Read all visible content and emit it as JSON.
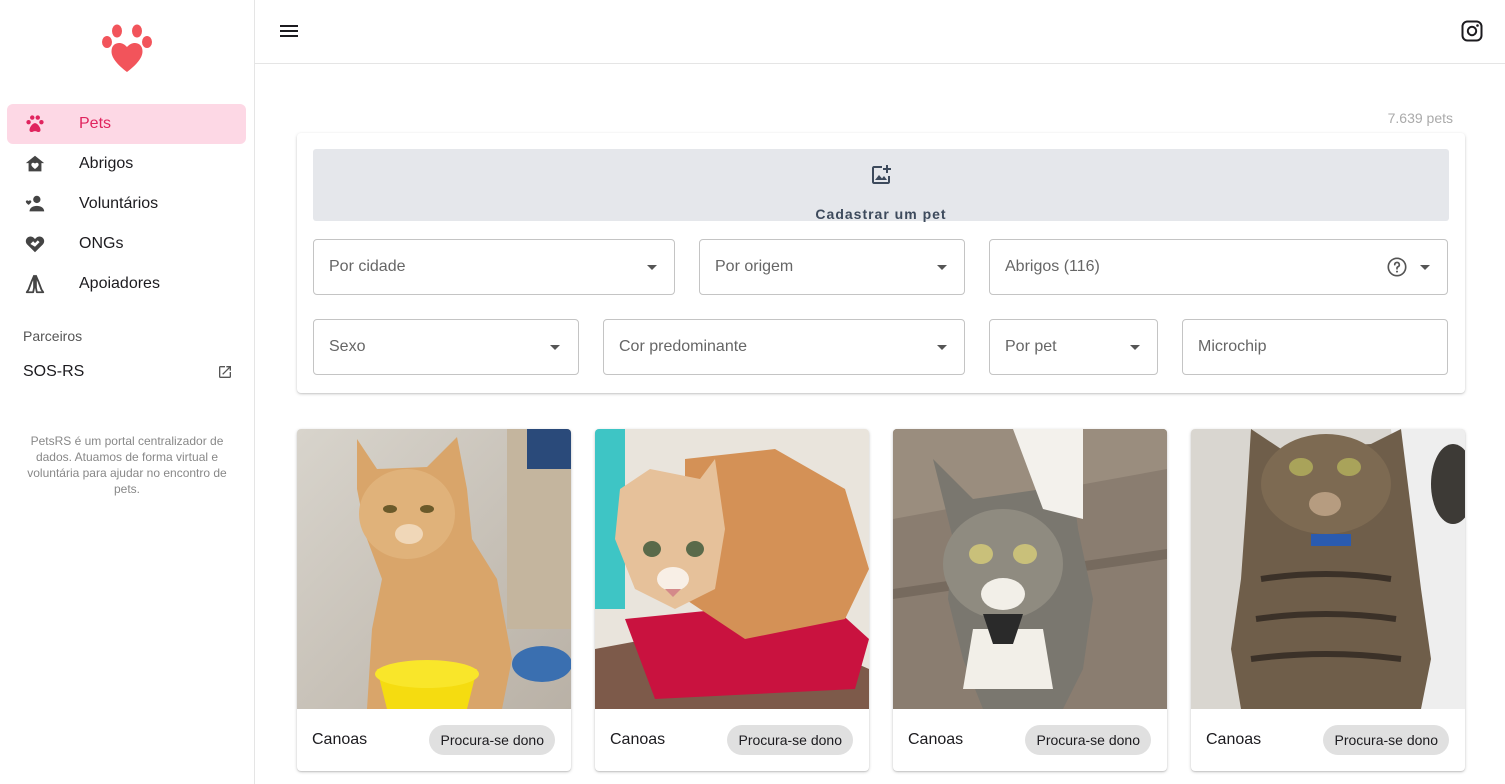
{
  "sidebar": {
    "items": [
      {
        "label": "Pets",
        "icon": "paw-icon",
        "active": true
      },
      {
        "label": "Abrigos",
        "icon": "house-heart-icon",
        "active": false
      },
      {
        "label": "Voluntários",
        "icon": "volunteer-icon",
        "active": false
      },
      {
        "label": "ONGs",
        "icon": "handshake-icon",
        "active": false
      },
      {
        "label": "Apoiadores",
        "icon": "praying-hands-icon",
        "active": false
      }
    ],
    "partners_title": "Parceiros",
    "partners": [
      {
        "label": "SOS-RS",
        "icon": "external-link-icon"
      }
    ],
    "about": "PetsRS é um portal centralizador de dados. Atuamos de forma virtual e voluntária para ajudar no encontro de pets."
  },
  "topbar": {
    "menu_icon": "hamburger-menu-icon",
    "social_icon": "instagram-icon"
  },
  "main": {
    "pet_count": "7.639 pets",
    "register_label": "Cadastrar um pet",
    "filters": {
      "city": "Por cidade",
      "origin": "Por origem",
      "shelters": "Abrigos (116)",
      "sex": "Sexo",
      "color": "Cor predominante",
      "pet": "Por pet",
      "microchip": "Microchip"
    },
    "pets": [
      {
        "city": "Canoas",
        "status": "Procura-se dono"
      },
      {
        "city": "Canoas",
        "status": "Procura-se dono"
      },
      {
        "city": "Canoas",
        "status": "Procura-se dono"
      },
      {
        "city": "Canoas",
        "status": "Procura-se dono"
      }
    ]
  },
  "colors": {
    "accent": "#e0245e",
    "active_bg": "#fdd8e5",
    "logo": "#f2545b"
  }
}
